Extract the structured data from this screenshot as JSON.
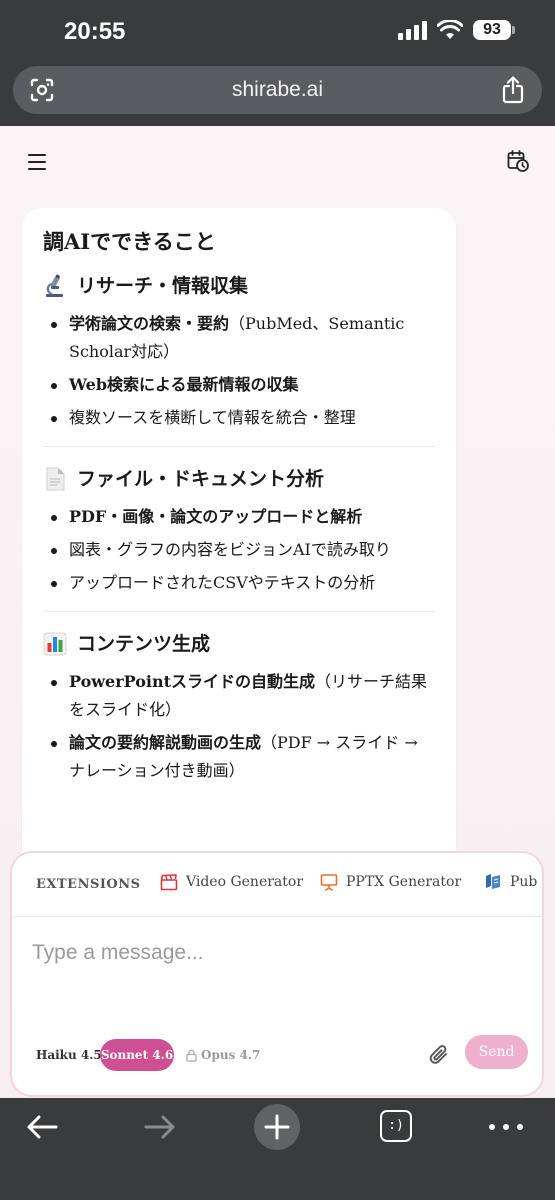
{
  "status_bar": {
    "time": "20:55",
    "battery": "93"
  },
  "browser": {
    "url": "shirabe.ai"
  },
  "card": {
    "title": "調AIでできること",
    "sections": [
      {
        "icon": "microscope-icon",
        "title": "リサーチ・情報収集",
        "items": [
          {
            "bold": "学術論文の検索・要約",
            "rest": "（PubMed、Semantic Scholar対応）"
          },
          {
            "bold": "Web検索による最新情報の収集",
            "rest": ""
          },
          {
            "bold": "",
            "rest": "複数ソースを横断して情報を統合・整理"
          }
        ]
      },
      {
        "icon": "document-icon",
        "title": "ファイル・ドキュメント分析",
        "items": [
          {
            "bold": "PDF・画像・論文のアップロードと解析",
            "rest": ""
          },
          {
            "bold": "",
            "rest": "図表・グラフの内容をビジョンAIで読み取り"
          },
          {
            "bold": "",
            "rest": "アップロードされたCSVやテキストの分析"
          }
        ]
      },
      {
        "icon": "bar-chart-icon",
        "title": "コンテンツ生成",
        "items": [
          {
            "bold": "PowerPointスライドの自動生成",
            "rest": "（リサーチ結果をスライド化）"
          },
          {
            "bold": "論文の要約解説動画の生成",
            "rest": "（PDF → スライド → ナレーション付き動画）"
          }
        ]
      }
    ]
  },
  "composer": {
    "extensions_label": "EXTENSIONS",
    "extensions": [
      {
        "label": "Video Generator",
        "icon": "clapperboard-icon",
        "color": "#d9363e"
      },
      {
        "label": "PPTX Generator",
        "icon": "presentation-icon",
        "color": "#e8702a"
      },
      {
        "label": "Pub",
        "icon": "book-icon",
        "color": "#2d6bb5"
      }
    ],
    "placeholder": "Type a message...",
    "models": {
      "haiku": "Haiku 4.5",
      "sonnet": "Sonnet 4.6",
      "opus": "Opus 4.7"
    },
    "send_label": "Send"
  },
  "toolbar": {
    "tabs_label": ":)"
  },
  "colors": {
    "accent": "#cf4f93",
    "send_disabled": "#eeb0cd",
    "chrome": "#3a3b3d"
  }
}
